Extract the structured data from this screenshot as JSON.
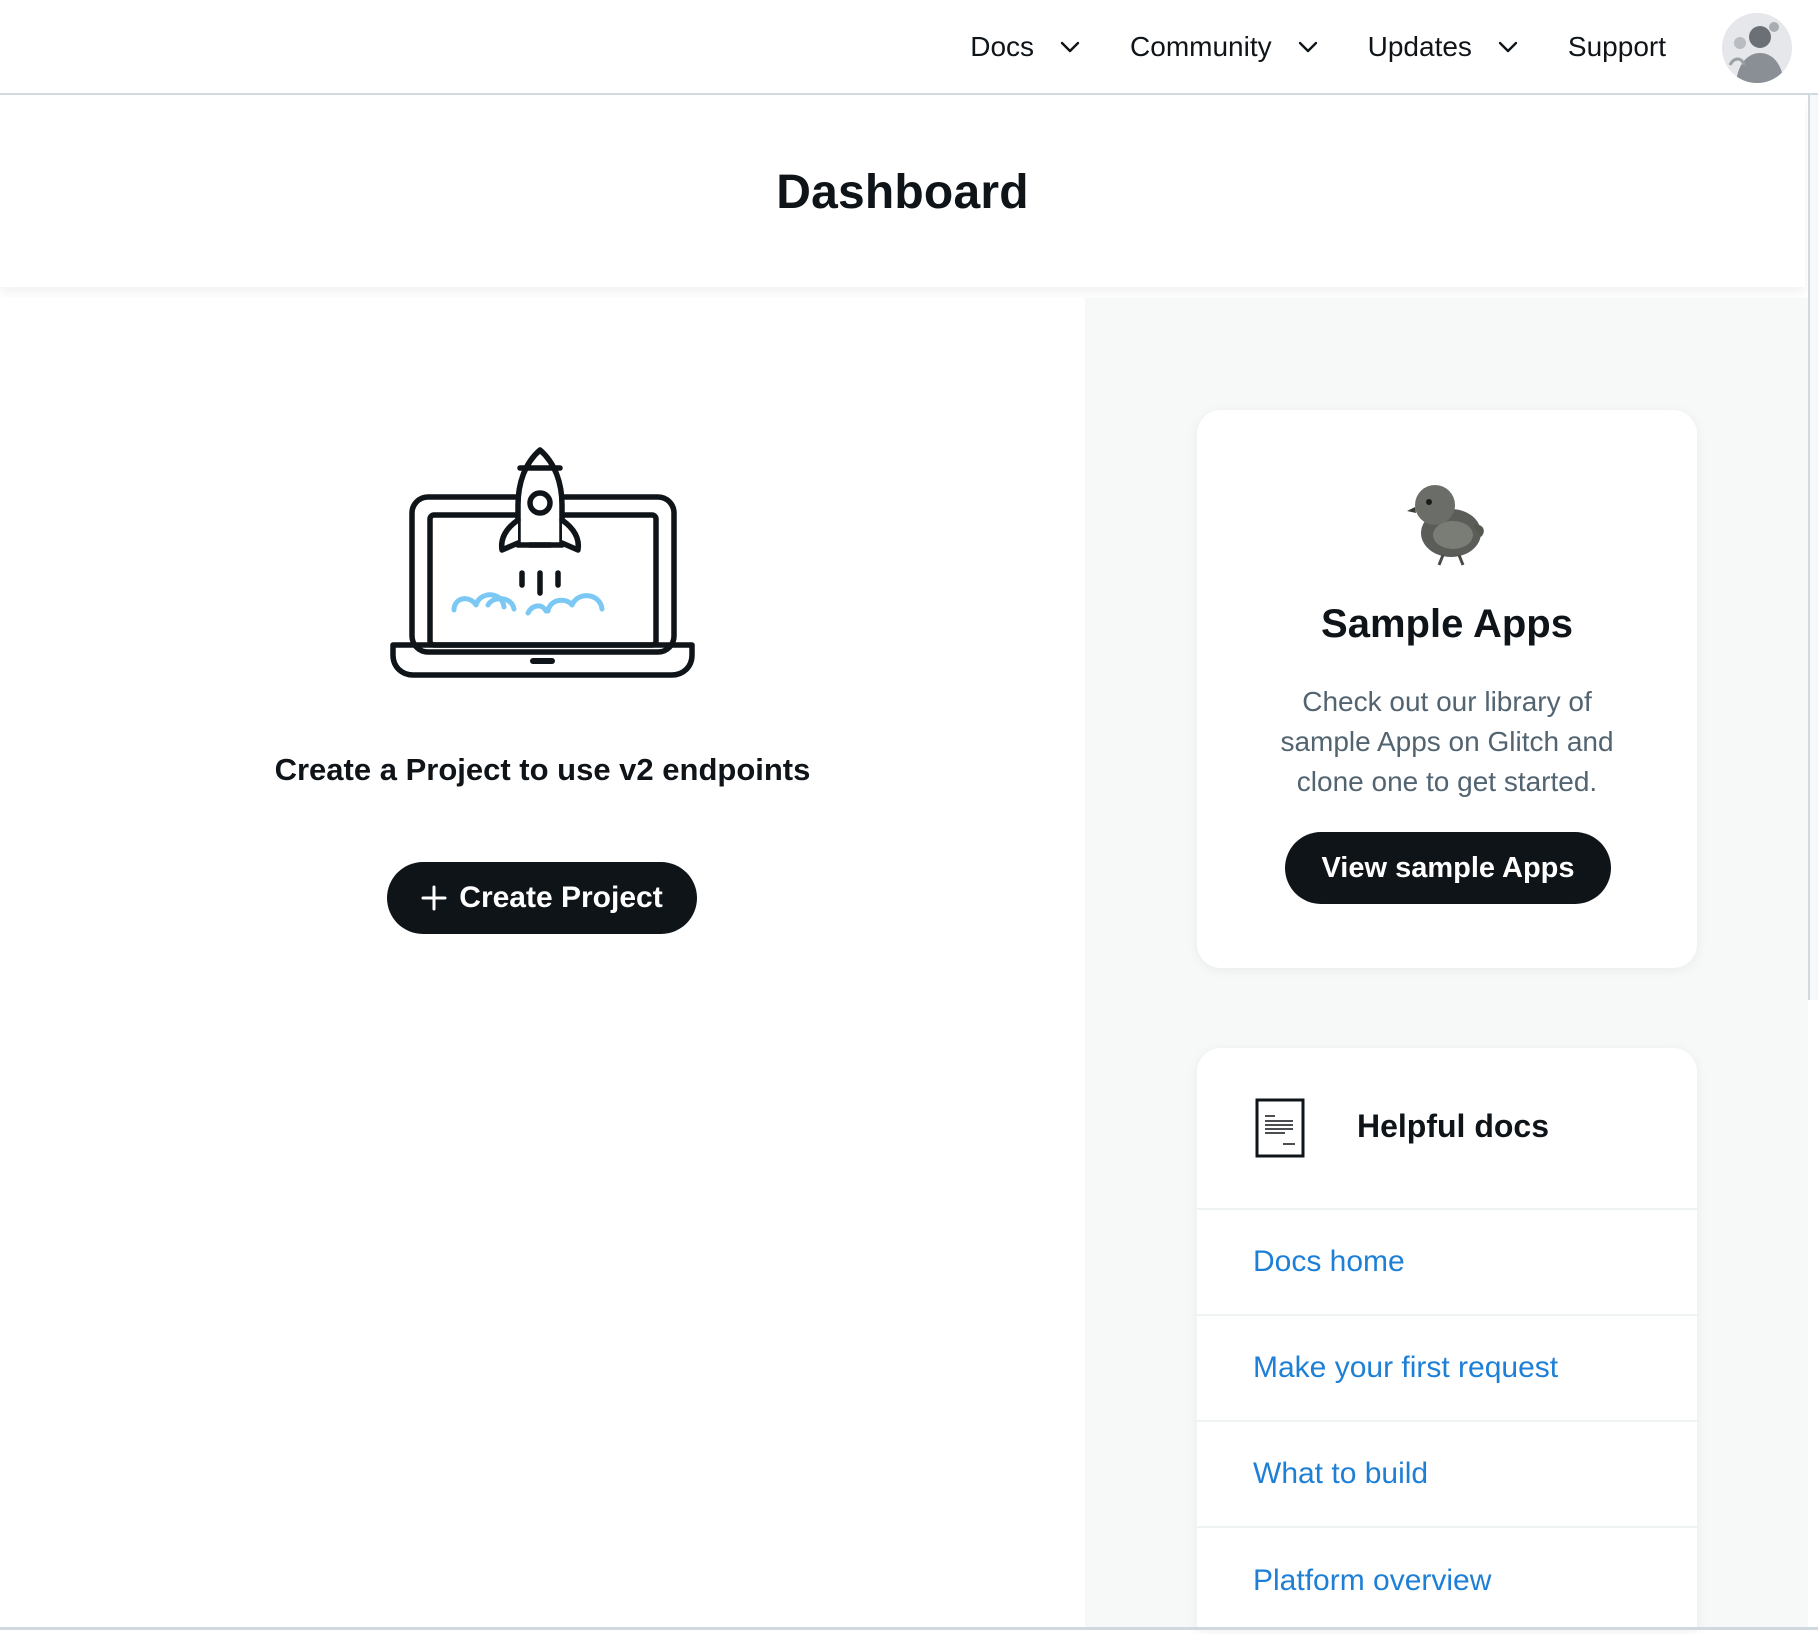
{
  "nav": {
    "items": [
      {
        "label": "Docs",
        "has_dropdown": true
      },
      {
        "label": "Community",
        "has_dropdown": true
      },
      {
        "label": "Updates",
        "has_dropdown": true
      },
      {
        "label": "Support",
        "has_dropdown": false
      }
    ],
    "avatar_icon": "user-avatar"
  },
  "page": {
    "title": "Dashboard"
  },
  "create": {
    "illustration_icon": "laptop-rocket-icon",
    "headline": "Create a Project to use v2 endpoints",
    "button_label": "Create Project"
  },
  "sample_apps": {
    "icon": "chick-icon",
    "title": "Sample Apps",
    "description": "Check out our library of sample Apps on Glitch and clone one to get started.",
    "button_label": "View sample Apps"
  },
  "helpful_docs": {
    "icon": "document-icon",
    "title": "Helpful docs",
    "links": [
      {
        "label": "Docs home"
      },
      {
        "label": "Make your first request"
      },
      {
        "label": "What to build"
      },
      {
        "label": "Platform overview"
      }
    ]
  },
  "colors": {
    "text_primary": "#0f1419",
    "text_secondary": "#536471",
    "link": "#1d7fd6",
    "button_bg": "#0f1419",
    "panel_bg": "#f7f9f9",
    "cloud_blue": "#7cc8f5"
  }
}
